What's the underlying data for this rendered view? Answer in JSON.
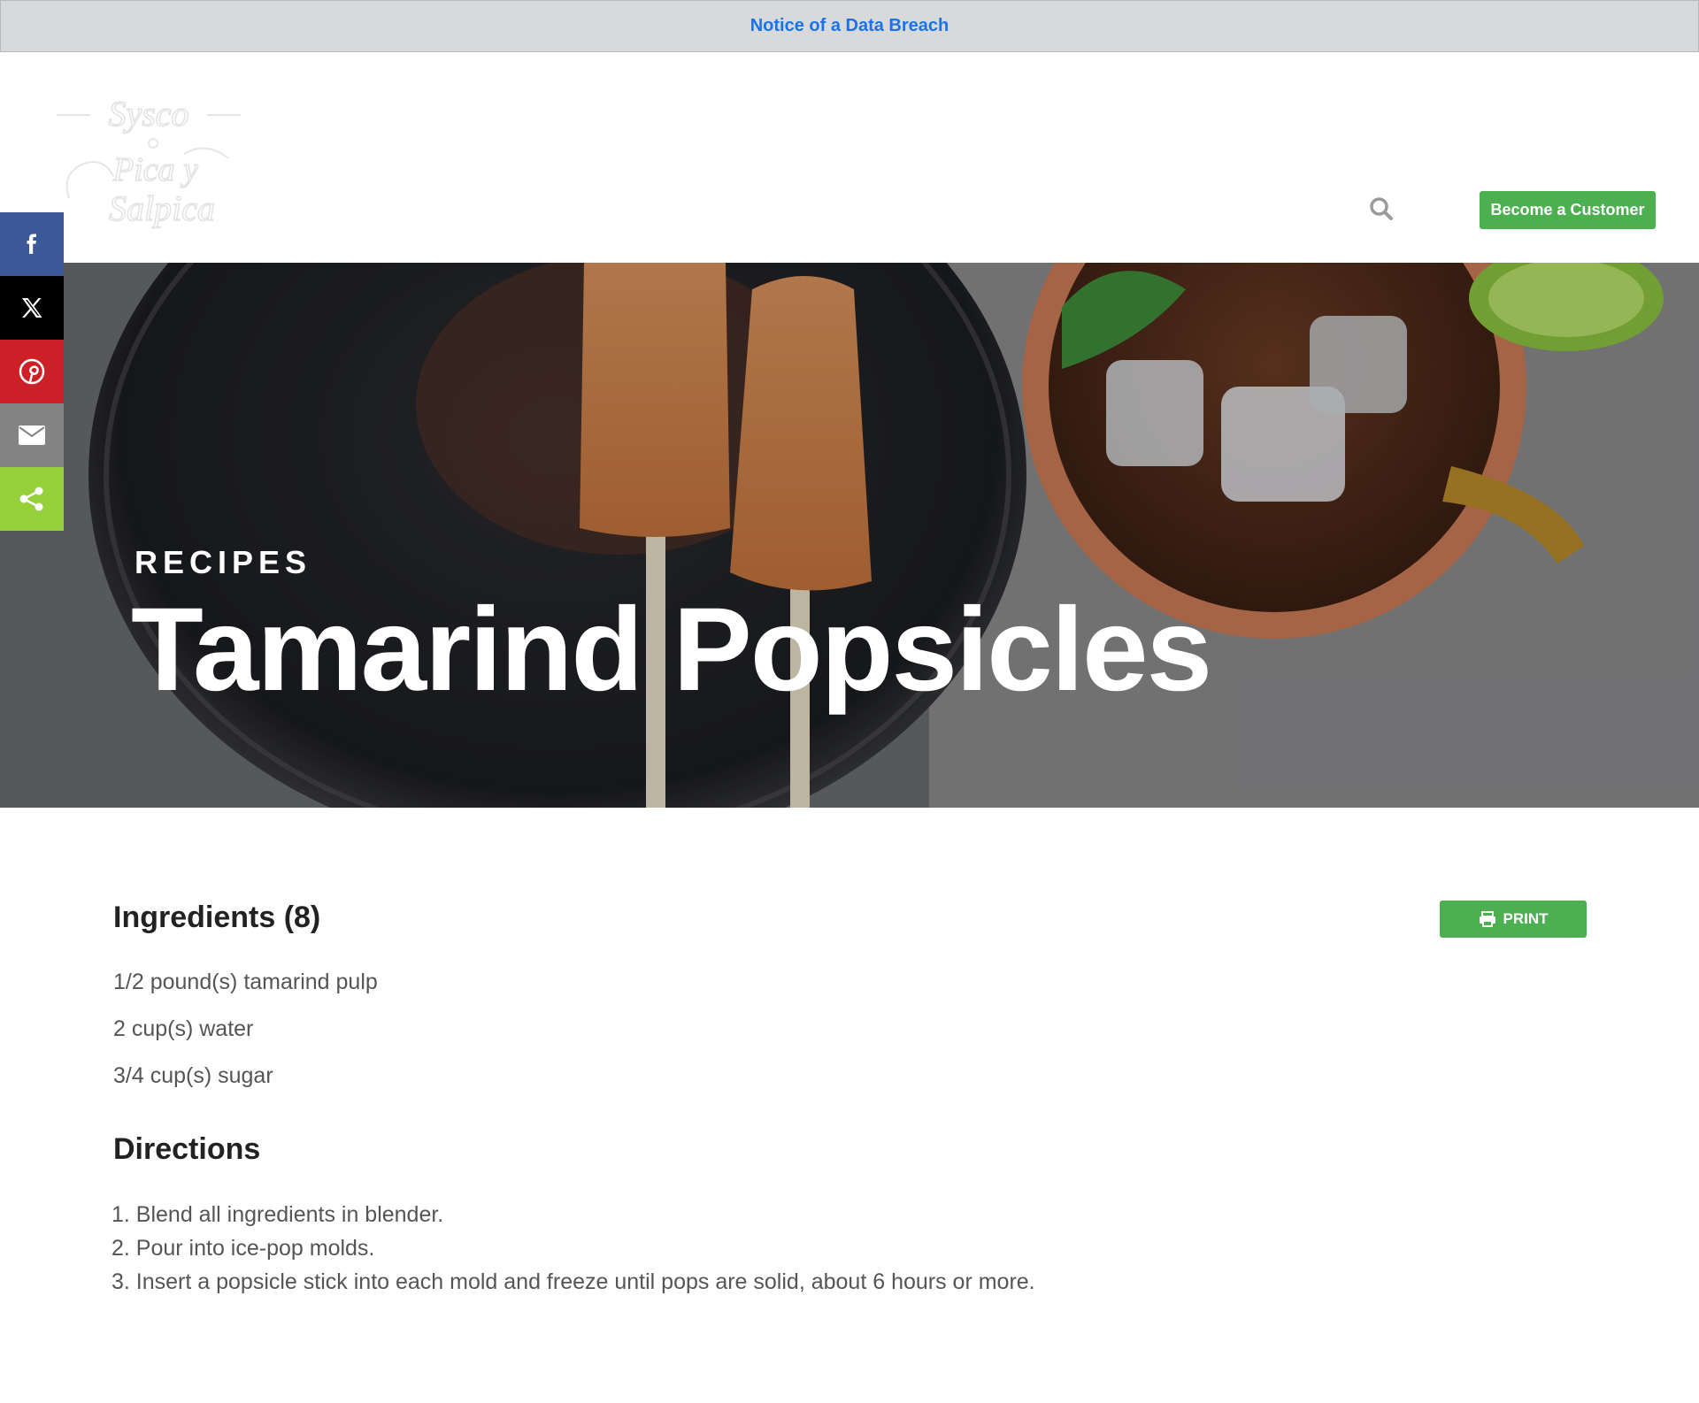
{
  "notice": {
    "text": "Notice of a Data Breach"
  },
  "header": {
    "logo": {
      "brand": "Sysco",
      "line1": "Pica y",
      "line2": "Salpica"
    },
    "cta_label": "Become a Customer"
  },
  "share": {
    "buttons": [
      {
        "name": "facebook",
        "icon": "facebook-icon",
        "color": "#3b5998"
      },
      {
        "name": "x",
        "icon": "x-icon",
        "color": "#000000"
      },
      {
        "name": "pinterest",
        "icon": "pinterest-icon",
        "color": "#cb2027"
      },
      {
        "name": "email",
        "icon": "email-icon",
        "color": "#848484"
      },
      {
        "name": "share",
        "icon": "share-icon",
        "color": "#95d03a"
      }
    ]
  },
  "hero": {
    "kicker": "RECIPES",
    "title": "Tamarind Popsicles"
  },
  "recipe": {
    "ingredients_title": "Ingredients (8)",
    "print_label": "PRINT",
    "ingredients": [
      "1/2 pound(s) tamarind pulp",
      "2 cup(s) water",
      "3/4 cup(s) sugar"
    ],
    "directions_title": "Directions",
    "directions": [
      "1. Blend all ingredients in blender.",
      "2. Pour into ice-pop molds.",
      "3. Insert a popsicle stick into each mold and freeze until pops are solid, about 6 hours or more."
    ]
  },
  "colors": {
    "accent_green": "#4caf50",
    "notice_link": "#1a73e8",
    "heading": "#222222",
    "body_text": "#555555"
  }
}
